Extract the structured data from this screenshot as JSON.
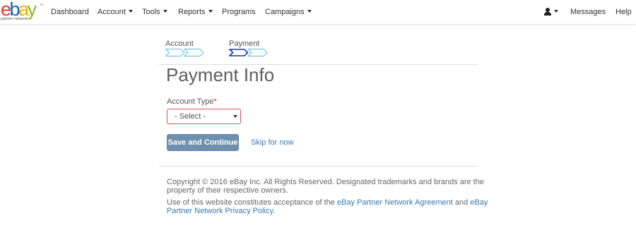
{
  "brand": {
    "letters": [
      {
        "char": "e",
        "color": "#e53238"
      },
      {
        "char": "b",
        "color": "#0064d2"
      },
      {
        "char": "a",
        "color": "#f5af02"
      },
      {
        "char": "y",
        "color": "#86b817"
      }
    ],
    "trademark": "™",
    "subtitle": "partner network"
  },
  "nav": {
    "dashboard": "Dashboard",
    "account": "Account",
    "tools": "Tools",
    "reports": "Reports",
    "programs": "Programs",
    "campaigns": "Campaigns",
    "messages": "Messages",
    "help": "Help"
  },
  "steps": [
    {
      "label": "Account",
      "state": "completed",
      "color": "#5bc0de"
    },
    {
      "label": "Payment",
      "state": "current",
      "color": "#1f3a93"
    }
  ],
  "form": {
    "title": "Payment Info",
    "account_type_label": "Account Type",
    "required_marker": "*",
    "select_value": "- Select -",
    "save_button": "Save and Continue",
    "skip_link": "Skip for now"
  },
  "footer": {
    "copyright_line1": "Copyright © 2016 eBay Inc. All Rights Reserved. Designated trademarks and brands are the",
    "copyright_line2": "property of their respective owners.",
    "terms_prefix": "Use of this website constitutes acceptance of the",
    "agreement_link": "eBay Partner Network Agreement",
    "and_text": "and",
    "privacy_link_part1": "eBay",
    "privacy_link_part2": "Partner Network Privacy Policy",
    "period": "."
  },
  "colors": {
    "link": "#337ab7",
    "primary_button": "#6f8fae",
    "error_border": "#d9534f"
  }
}
